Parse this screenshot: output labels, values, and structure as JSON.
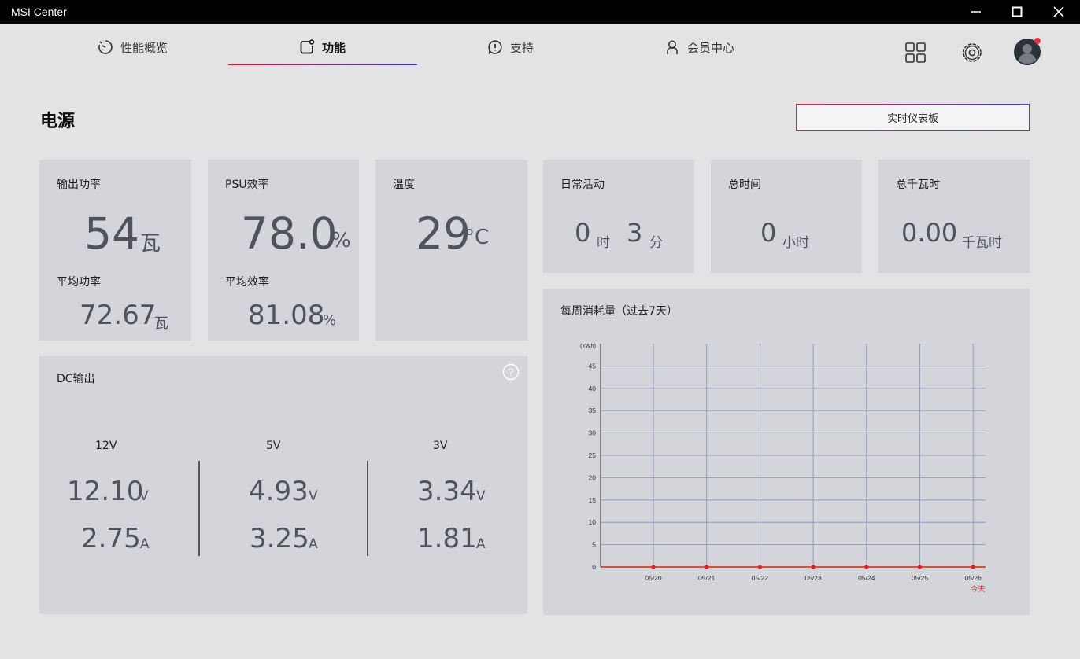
{
  "window": {
    "title": "MSI Center"
  },
  "nav": {
    "tabs": [
      {
        "label": "性能概览"
      },
      {
        "label": "功能"
      },
      {
        "label": "支持"
      },
      {
        "label": "会员中心"
      }
    ]
  },
  "page": {
    "title": "电源",
    "dashboard_button": "实时仪表板"
  },
  "output_power": {
    "label": "输出功率",
    "value": "54",
    "unit": "瓦",
    "avg_label": "平均功率",
    "avg_value": "72.67",
    "avg_unit": "瓦"
  },
  "psu_efficiency": {
    "label": "PSU效率",
    "value": "78.0",
    "unit": "%",
    "avg_label": "平均效率",
    "avg_value": "81.08",
    "avg_unit": "%"
  },
  "temperature": {
    "label": "温度",
    "value": "29",
    "unit": "°C"
  },
  "daily_activity": {
    "label": "日常活动",
    "hours": "0",
    "hours_unit": "时",
    "minutes": "3",
    "minutes_unit": "分"
  },
  "total_time": {
    "label": "总时间",
    "value": "0",
    "unit": "小时"
  },
  "total_kwh": {
    "label": "总千瓦时",
    "value": "0.00",
    "unit": "千瓦时"
  },
  "dc_output": {
    "label": "DC输出",
    "rails": [
      {
        "name": "12V",
        "voltage": "12.10",
        "v_unit": "V",
        "current": "2.75",
        "a_unit": "A"
      },
      {
        "name": "5V",
        "voltage": "4.93",
        "v_unit": "V",
        "current": "3.25",
        "a_unit": "A"
      },
      {
        "name": "3V",
        "voltage": "3.34",
        "v_unit": "V",
        "current": "1.81",
        "a_unit": "A"
      }
    ]
  },
  "weekly": {
    "label": "每周消耗量（过去7天）"
  },
  "chart_data": {
    "type": "line",
    "title": "每周消耗量（过去7天）",
    "ylabel": "(kWh)",
    "xlabel": "",
    "categories": [
      "05/20",
      "05/21",
      "05/22",
      "05/23",
      "05/24",
      "05/25",
      "05/26"
    ],
    "today_label": "今天",
    "series": [
      {
        "values": [
          0,
          0,
          0,
          0,
          0,
          0,
          0
        ]
      }
    ],
    "yticks": [
      0,
      5,
      10,
      15,
      20,
      25,
      30,
      35,
      40,
      45
    ],
    "ylim": [
      0,
      50
    ],
    "grid": true,
    "line_color": "#e02020"
  },
  "colors": {
    "accent_red": "#e0203a",
    "accent_blue": "#3a3ad0",
    "notification_dot": "#e8323c"
  }
}
